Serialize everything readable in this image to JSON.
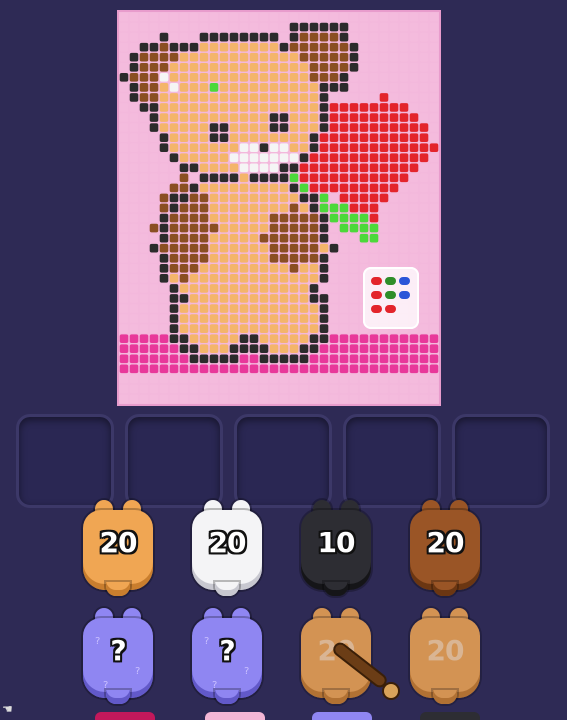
{
  "board": {
    "cols": 32,
    "rows": 39,
    "palette": {
      "bg": "#f4bbdd",
      "black": "#2b2b2b",
      "brown": "#8a4f22",
      "tan": "#f4b56a",
      "white": "#f5f5f5",
      "red": "#e3242b",
      "green": "#4cd93a",
      "magenta": "#e8389a"
    },
    "jar_candy_colors": [
      "#e3242b",
      "#2f8e2a",
      "#2a55d8",
      "#e3242b",
      "#2f8e2a",
      "#2a55d8",
      "#e3242b",
      "#e3242b"
    ]
  },
  "slots": {
    "count": 5,
    "state": "empty"
  },
  "spools": [
    {
      "label": "20",
      "color": "#f0a653",
      "shade": "#c97e2e",
      "state": "ready"
    },
    {
      "label": "20",
      "color": "#f4f4f6",
      "shade": "#c8c8d0",
      "state": "ready"
    },
    {
      "label": "10",
      "color": "#2d2d33",
      "shade": "#151518",
      "state": "ready"
    },
    {
      "label": "20",
      "color": "#9a5526",
      "shade": "#6b3612",
      "state": "ready"
    },
    {
      "label": "?",
      "color": "#8f86f2",
      "shade": "#6259c9",
      "state": "hidden"
    },
    {
      "label": "?",
      "color": "#8f86f2",
      "shade": "#6259c9",
      "state": "hidden"
    },
    {
      "label": "20",
      "color": "#f0a653",
      "shade": "#c97e2e",
      "state": "faded"
    },
    {
      "label": "20",
      "color": "#f0a653",
      "shade": "#c97e2e",
      "state": "faded"
    }
  ]
}
